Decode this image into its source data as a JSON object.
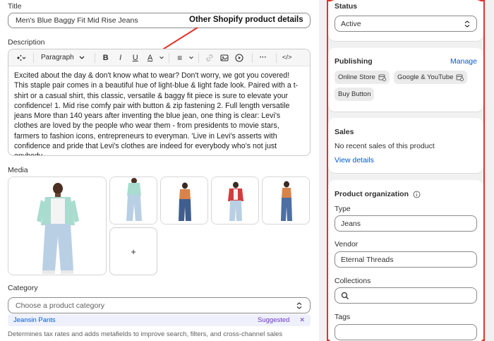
{
  "title_section": {
    "label": "Title",
    "value": "Men's Blue Baggy Fit Mid Rise Jeans"
  },
  "annotation": "Other Shopify product details",
  "description": {
    "label": "Description",
    "toolbar": {
      "paragraph_label": "Paragraph",
      "bold": "B",
      "italic": "I",
      "underline": "U",
      "color": "A",
      "align": "≡",
      "more": "···",
      "code": "</>"
    },
    "text": "Excited about the day & don't know what to wear? Don't worry, we got you covered! This staple pair comes in a beautiful hue of light-blue & light fade look. Paired with a t-shirt or a casual shirt, this classic, versatile & baggy fit piece is sure to elevate your confidence! 1. Mid rise comfy pair with button & zip fastening 2. Full length versatile jeans More than 140 years after inventing the blue jean, one thing is clear: Levi's clothes are loved by the people who wear them - from presidents to movie stars, farmers to fashion icons, entrepreneurs to everyman. 'Live in Levi's asserts with confidence and pride that Levi's clothes are indeed for everybody who's not just anybody."
  },
  "media": {
    "label": "Media",
    "add_label": "+"
  },
  "category": {
    "label": "Category",
    "placeholder": "Choose a product category",
    "suggestion_link": "Jeans",
    "suggestion_rest": " in Pants",
    "suggested_label": "Suggested",
    "dismiss": "✕",
    "hint": "Determines tax rates and adds metafields to improve search, filters, and cross-channel sales"
  },
  "status": {
    "title": "Status",
    "value": "Active"
  },
  "publishing": {
    "title": "Publishing",
    "manage": "Manage",
    "channels": [
      "Online Store",
      "Google & YouTube",
      "Buy Button"
    ]
  },
  "sales": {
    "title": "Sales",
    "text": "No recent sales of this product",
    "link": "View details"
  },
  "organization": {
    "title": "Product organization",
    "type_label": "Type",
    "type_value": "Jeans",
    "vendor_label": "Vendor",
    "vendor_value": "Eternal Threads",
    "collections_label": "Collections",
    "tags_label": "Tags"
  },
  "colors": {
    "highlight_border": "#e4322b",
    "link": "#005bd3",
    "suggested": "#6c38c7"
  }
}
